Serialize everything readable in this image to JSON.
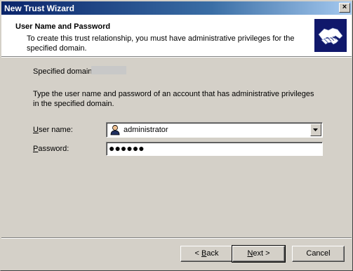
{
  "window": {
    "title": "New Trust Wizard",
    "close_label": "×"
  },
  "header": {
    "title": "User Name and Password",
    "subtitle": "To create this trust relationship, you must have administrative privileges for the specified domain."
  },
  "domain": {
    "label": "Specified domain:",
    "value": ""
  },
  "instructions": "Type the user name and password of an account that has administrative privileges in the specified domain.",
  "user": {
    "label_mnemonic": "U",
    "label_rest": "ser name:",
    "value": "administrator"
  },
  "password": {
    "label_mnemonic": "P",
    "label_rest": "assword:",
    "value": "●●●●●●"
  },
  "buttons": {
    "back_prefix": "< ",
    "back_mnemonic": "B",
    "back_rest": "ack",
    "next_mnemonic": "N",
    "next_rest": "ext >",
    "cancel": "Cancel"
  },
  "colors": {
    "title_start": "#0a246a",
    "title_end": "#a6caf0",
    "face": "#d4d0c8",
    "icon_bg": "#10186b"
  },
  "icons": {
    "wizard": "handshake-icon",
    "user": "user-icon",
    "dropdown": "chevron-down-icon"
  }
}
